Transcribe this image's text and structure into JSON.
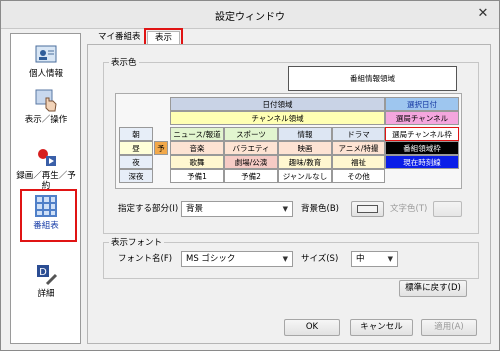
{
  "window": {
    "title": "設定ウィンドウ",
    "close_glyph": "✕"
  },
  "sidebar": {
    "items": [
      {
        "label": "個人情報",
        "icon": "id-card-icon"
      },
      {
        "label": "表示／操作",
        "icon": "hand-pointer-icon"
      },
      {
        "label": "録画／再生／予約",
        "icon": "record-icon"
      },
      {
        "label": "番組表",
        "icon": "grid-icon",
        "selected": true
      },
      {
        "label": "詳細",
        "icon": "detail-icon"
      }
    ]
  },
  "tabs": [
    {
      "label": "マイ番組表"
    },
    {
      "label": "表示",
      "active": true
    }
  ],
  "display_color": {
    "group_label": "表示色",
    "program_info_area": "番組情報領域",
    "date_area": "日付領域",
    "selected_date": "選択日付",
    "channel_area": "チャンネル領域",
    "selected_channel": "選局チャンネル",
    "time_labels": [
      "朝",
      "昼",
      "夜",
      "深夜"
    ],
    "yo_label": "予",
    "genres": [
      "ニュース/報道",
      "スポーツ",
      "情報",
      "ドラマ",
      "音楽",
      "バラエティ",
      "映画",
      "アニメ/特撮",
      "歌舞",
      "劇場/公演",
      "趣味/教育",
      "福祉",
      "予備1",
      "予備2",
      "ジャンルなし",
      "その他"
    ],
    "selected_channel_frame": "選局チャンネル枠",
    "program_frame": "番組領域枠",
    "current_time_line": "現在時刻線",
    "target_label": "指定する部分(I)",
    "target_value": "背景",
    "bg_color_label": "背景色(B)",
    "text_color_label": "文字色(T)"
  },
  "display_font": {
    "group_label": "表示フォント",
    "font_label": "フォント名(F)",
    "font_value": "MS ゴシック",
    "size_label": "サイズ(S)",
    "size_value": "中"
  },
  "buttons": {
    "reset": "標準に戻す(D)",
    "ok": "OK",
    "cancel": "キャンセル",
    "apply": "適用(A)"
  },
  "colors": {
    "accent_red": "#e01414",
    "date_area_bg": "#c9d3e6",
    "selected_date_bg": "#9ec6ef",
    "channel_bg": "#ffffb3",
    "selected_channel_bg": "#f4a6de",
    "program_frame_bg": "#000000",
    "current_time_bg": "#0a1ee8"
  }
}
